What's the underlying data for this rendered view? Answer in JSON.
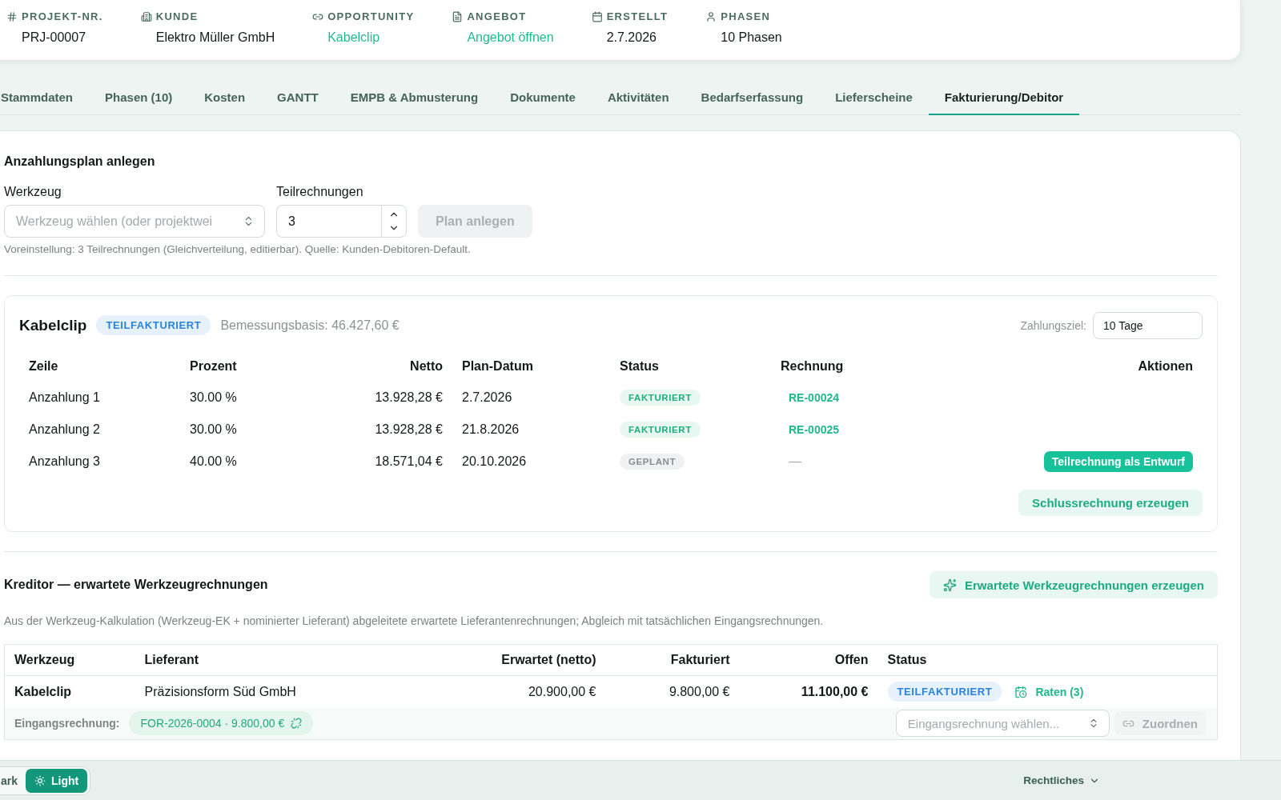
{
  "project_header": {
    "fields": [
      {
        "kind": "hash",
        "label": "PROJEKT-NR.",
        "value": "PRJ-00007",
        "link": false
      },
      {
        "kind": "building",
        "label": "KUNDE",
        "value": "Elektro Müller GmbH",
        "link": false
      },
      {
        "kind": "chain",
        "label": "OPPORTUNITY",
        "value": "Kabelclip",
        "link": true
      },
      {
        "kind": "document",
        "label": "ANGEBOT",
        "value": "Angebot öffnen",
        "link": true
      },
      {
        "kind": "calendar",
        "label": "ERSTELLT",
        "value": "2.7.2026",
        "link": false
      },
      {
        "kind": "person",
        "label": "PHASEN",
        "value": "10 Phasen",
        "link": false
      }
    ]
  },
  "tabs": [
    {
      "label": "Stammdaten",
      "selected": false
    },
    {
      "label": "Phasen (10)",
      "selected": false
    },
    {
      "label": "Kosten",
      "selected": false
    },
    {
      "label": "GANTT",
      "selected": false
    },
    {
      "label": "EMPB & Abmusterung",
      "selected": false
    },
    {
      "label": "Dokumente",
      "selected": false
    },
    {
      "label": "Aktivitäten",
      "selected": false
    },
    {
      "label": "Bedarfserfassung",
      "selected": false
    },
    {
      "label": "Lieferscheine",
      "selected": false
    },
    {
      "label": "Fakturierung/Debitor",
      "selected": true
    }
  ],
  "installment_plan": {
    "title": "Anzahlungsplan anlegen",
    "tool_field": {
      "label": "Werkzeug",
      "placeholder": "Werkzeug wählen (oder projektwei"
    },
    "count_field": {
      "label": "Teilrechnungen",
      "value": "3"
    },
    "create_button": {
      "label": "Plan anlegen",
      "disabled": true
    },
    "hint": "Voreinstellung: 3 Teilrechnungen (Gleichverteilung, editierbar). Quelle: Kunden-Debitoren-Default."
  },
  "tool_plan": {
    "title": "Kabelclip",
    "status": {
      "label": "TEILFAKTURIERT",
      "kind": "partial"
    },
    "basis": "Bemessungsbasis: 46.427,60 €",
    "payment_term": {
      "label": "Zahlungsziel:",
      "value": "10 Tage"
    },
    "columns": [
      "Zeile",
      "Prozent",
      "Netto",
      "Plan-Datum",
      "Status",
      "Rechnung",
      "Aktionen"
    ],
    "rows": [
      {
        "line": "Anzahlung 1",
        "percent": "30.00 %",
        "net": "13.928,28 €",
        "date": "2.7.2026",
        "status": {
          "label": "FAKTURIERT",
          "kind": "billed"
        },
        "invoice": {
          "text": "RE-00024",
          "kind": "link"
        }
      },
      {
        "line": "Anzahlung 2",
        "percent": "30.00 %",
        "net": "13.928,28 €",
        "date": "21.8.2026",
        "status": {
          "label": "FAKTURIERT",
          "kind": "billed"
        },
        "invoice": {
          "text": "RE-00025",
          "kind": "link"
        }
      },
      {
        "line": "Anzahlung 3",
        "percent": "40.00 %",
        "net": "18.571,04 €",
        "date": "20.10.2026",
        "status": {
          "label": "GEPLANT",
          "kind": "planned"
        },
        "invoice": {
          "text": "—",
          "kind": "none"
        },
        "action": "Teilrechnung als Entwurf"
      }
    ],
    "final_button": "Schlussrechnung erzeugen"
  },
  "creditor": {
    "title": "Kreditor — erwartete Werkzeugrechnungen",
    "generate_button": "Erwartete Werkzeugrechnungen erzeugen",
    "description": "Aus der Werkzeug-Kalkulation (Werkzeug-EK + nominierter Lieferant) abgeleitete erwartete Lieferantenrechnungen; Abgleich mit tatsächlichen Eingangsrechnungen.",
    "columns": [
      "Werkzeug",
      "Lieferant",
      "Erwartet (netto)",
      "Fakturiert",
      "Offen",
      "Status"
    ],
    "rows": [
      {
        "tool": "Kabelclip",
        "supplier": "Präzisionsform Süd GmbH",
        "expected": "20.900,00 €",
        "billed": "9.800,00 €",
        "open": "11.100,00 €",
        "status": {
          "label": "TEILFAKTURIERT",
          "kind": "partial"
        },
        "installments_link": "Raten (3)",
        "incoming": {
          "label": "Eingangsrechnung:",
          "invoices": [
            "FOR-2026-0004 · 9.800,00 €"
          ],
          "select_placeholder": "Eingangsrechnung wählen...",
          "assign_button": {
            "label": "Zuordnen",
            "disabled": true
          }
        }
      }
    ]
  },
  "footer": {
    "theme_options": [
      {
        "label": "ark",
        "kind": "dark",
        "selected": false
      },
      {
        "label": "Light",
        "kind": "light",
        "selected": true
      }
    ],
    "legal_menu": "Rechtliches"
  }
}
